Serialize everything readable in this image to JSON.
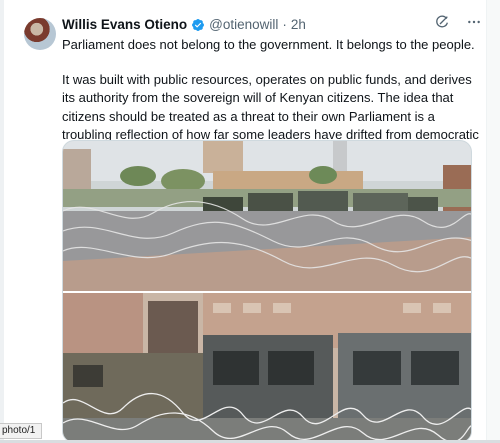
{
  "tweet": {
    "display_name": "Willis Evans Otieno",
    "handle": "@otienowill",
    "separator": "·",
    "time": "2h",
    "paragraphs": [
      "Parliament does not belong to the government. It belongs to the people.",
      "It was built with public resources, operates on public funds, and derives its authority from the sovereign will of Kenyan citizens. The idea that citizens should be treated as a threat to their own Parliament is a troubling reflection of how far some leaders have drifted from democratic principles."
    ]
  },
  "icons": {
    "verified": "verified-badge-icon",
    "grok": "grok-icon",
    "more": "more-icon"
  },
  "status_bar": {
    "url_fragment": "photo/1"
  },
  "colors": {
    "verified_blue": "#1d9bf0",
    "text": "#0f1419",
    "muted": "#536471"
  }
}
